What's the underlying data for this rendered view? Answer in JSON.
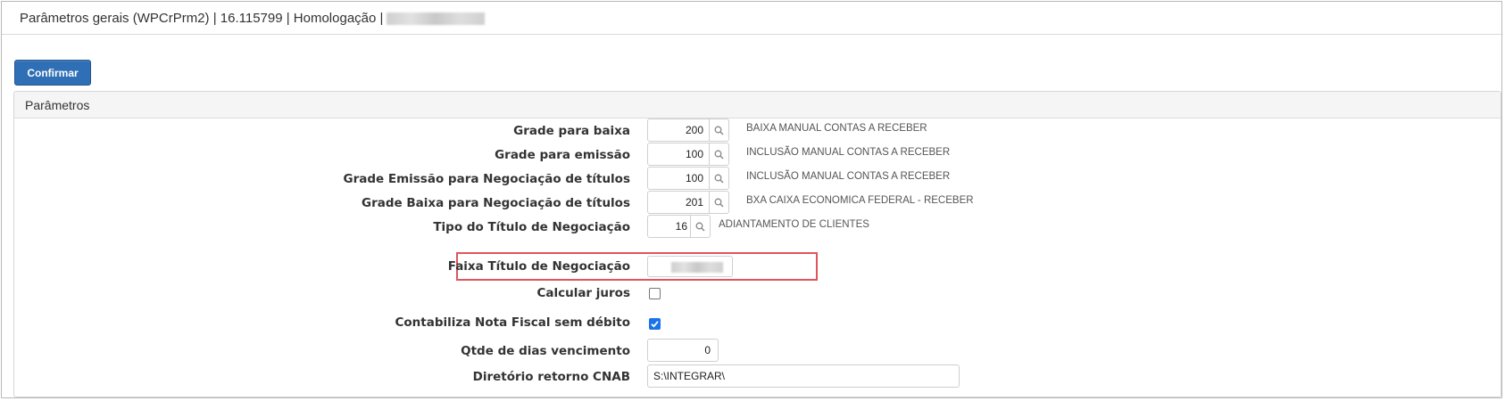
{
  "window": {
    "title": "Parâmetros gerais (WPCrPrm2) | 16.115799 | Homologação |"
  },
  "toolbar": {
    "confirm_label": "Confirmar"
  },
  "panel": {
    "heading": "Parâmetros"
  },
  "fields": {
    "grade_baixa": {
      "label": "Grade para baixa",
      "value": "200",
      "description": "BAIXA MANUAL CONTAS A RECEBER"
    },
    "grade_emissao": {
      "label": "Grade para emissão",
      "value": "100",
      "description": "INCLUSÃO MANUAL CONTAS A RECEBER"
    },
    "grade_emissao_negociacao": {
      "label": "Grade Emissão para Negociação de títulos",
      "value": "100",
      "description": "INCLUSÃO MANUAL CONTAS A RECEBER"
    },
    "grade_baixa_negociacao": {
      "label": "Grade Baixa para Negociação de títulos",
      "value": "201",
      "description": "BXA CAIXA ECONOMICA FEDERAL - RECEBER"
    },
    "tipo_titulo_negociacao": {
      "label": "Tipo do Título de Negociação",
      "value": "16",
      "description": "ADIANTAMENTO DE CLIENTES"
    },
    "faixa_titulo_negociacao": {
      "label": "Faixa Título de Negociação"
    },
    "calcular_juros": {
      "label": "Calcular juros",
      "checked": false
    },
    "contabiliza_nf": {
      "label": "Contabiliza Nota Fiscal sem débito",
      "checked": true
    },
    "qtde_dias_vencimento": {
      "label": "Qtde de dias vencimento",
      "value": "0"
    },
    "diretorio_cnab": {
      "label": "Diretório retorno CNAB",
      "value": "S:\\INTEGRAR\\"
    }
  },
  "colors": {
    "primary_button": "#2f6fb5",
    "highlight_border": "#e0555c",
    "checkbox_checked": "#1a73e8"
  },
  "icons": {
    "lookup": "search-icon",
    "check": "check-icon"
  }
}
